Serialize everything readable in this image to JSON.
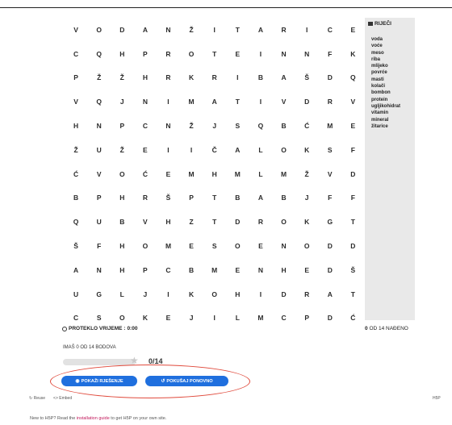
{
  "grid": [
    [
      "V",
      "O",
      "D",
      "A",
      "N",
      "Ž",
      "I",
      "T",
      "A",
      "R",
      "I",
      "C",
      "E"
    ],
    [
      "C",
      "Q",
      "H",
      "P",
      "R",
      "O",
      "T",
      "E",
      "I",
      "N",
      "N",
      "F",
      "K"
    ],
    [
      "P",
      "Ž",
      "Ž",
      "H",
      "R",
      "K",
      "R",
      "I",
      "B",
      "A",
      "Š",
      "D",
      "Q"
    ],
    [
      "V",
      "Q",
      "J",
      "N",
      "I",
      "M",
      "A",
      "T",
      "I",
      "V",
      "D",
      "R",
      "V"
    ],
    [
      "H",
      "N",
      "P",
      "C",
      "N",
      "Ž",
      "J",
      "S",
      "Q",
      "B",
      "Ć",
      "M",
      "E"
    ],
    [
      "Ž",
      "U",
      "Ž",
      "E",
      "I",
      "I",
      "Č",
      "A",
      "L",
      "O",
      "K",
      "S",
      "F"
    ],
    [
      "Ć",
      "V",
      "O",
      "Ć",
      "E",
      "M",
      "H",
      "M",
      "L",
      "M",
      "Ž",
      "V",
      "D"
    ],
    [
      "B",
      "P",
      "H",
      "R",
      "Š",
      "P",
      "T",
      "B",
      "A",
      "B",
      "J",
      "F",
      "F"
    ],
    [
      "Q",
      "U",
      "B",
      "V",
      "H",
      "Z",
      "T",
      "D",
      "R",
      "O",
      "K",
      "G",
      "T"
    ],
    [
      "Š",
      "F",
      "H",
      "O",
      "M",
      "E",
      "S",
      "O",
      "E",
      "N",
      "O",
      "D",
      "D"
    ],
    [
      "A",
      "N",
      "H",
      "P",
      "C",
      "B",
      "M",
      "E",
      "N",
      "H",
      "E",
      "D",
      "Š"
    ],
    [
      "U",
      "G",
      "L",
      "J",
      "I",
      "K",
      "O",
      "H",
      "I",
      "D",
      "R",
      "A",
      "T"
    ],
    [
      "C",
      "S",
      "O",
      "K",
      "E",
      "J",
      "I",
      "L",
      "M",
      "C",
      "P",
      "D",
      "Ć"
    ]
  ],
  "word_panel": {
    "title": "RIJEČI",
    "words": [
      "voda",
      "voće",
      "meso",
      "riba",
      "mlijeko",
      "povrće",
      "masti",
      "kolači",
      "bombon",
      "protein",
      "ugljikohidrat",
      "vitamin",
      "mineral",
      "žitarice"
    ]
  },
  "timer": {
    "label": "PROTEKLO VRIJEME :",
    "value": "0:00"
  },
  "found": {
    "count": "0",
    "text": "OD 14 NAĐENO"
  },
  "score": {
    "label": "IMAŠ 0 OD 14 BODOVA",
    "value": "0/14",
    "fraction": 0
  },
  "buttons": {
    "show_solution": "POKAŽI RJEŠENJE",
    "retry": "POKUŠAJ PONOVNO"
  },
  "footer": {
    "reuse": "Reuse",
    "embed": "Embed",
    "brand": "H5P"
  },
  "bottom_note": {
    "prefix": "New to H5P? Read the ",
    "link": "installation guide",
    "suffix": " to get H5P on your own site."
  },
  "colors": {
    "button": "#1f6fde",
    "annotation": "#e04a3c",
    "link": "#c2185b"
  }
}
